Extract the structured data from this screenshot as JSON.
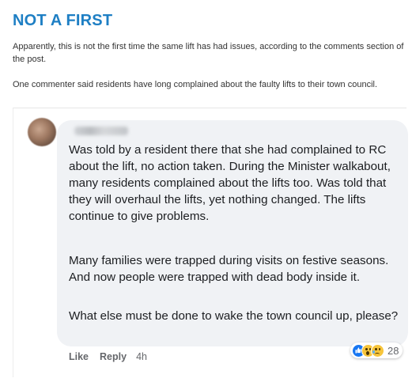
{
  "article": {
    "headline": "NOT A FIRST",
    "paragraphs": [
      "Apparently, this is not the first time the same lift has had issues, according to the comments section of the post.",
      "One commenter said residents have long complained about the faulty lifts to their town council."
    ]
  },
  "comment": {
    "paragraphs": [
      "Was told by a resident there that she had complained to RC about the lift, no action taken. During the Minister walkabout, many residents complained about the lifts too. Was told that they will overhaul the lifts, yet nothing changed. The lifts continue to give problems.",
      "Many families were trapped during visits on festive seasons. And now people were trapped with dead body inside it.",
      "What else must be done to wake the town council up, please?"
    ],
    "reactions": {
      "icons": [
        "like-icon",
        "wow-icon",
        "sad-icon"
      ],
      "count": "28"
    },
    "actions": {
      "like": "Like",
      "reply": "Reply",
      "time": "4h"
    }
  },
  "colors": {
    "headline": "#1e7fc4",
    "bubble": "#f0f2f5",
    "like_blue": "#1877f2"
  }
}
